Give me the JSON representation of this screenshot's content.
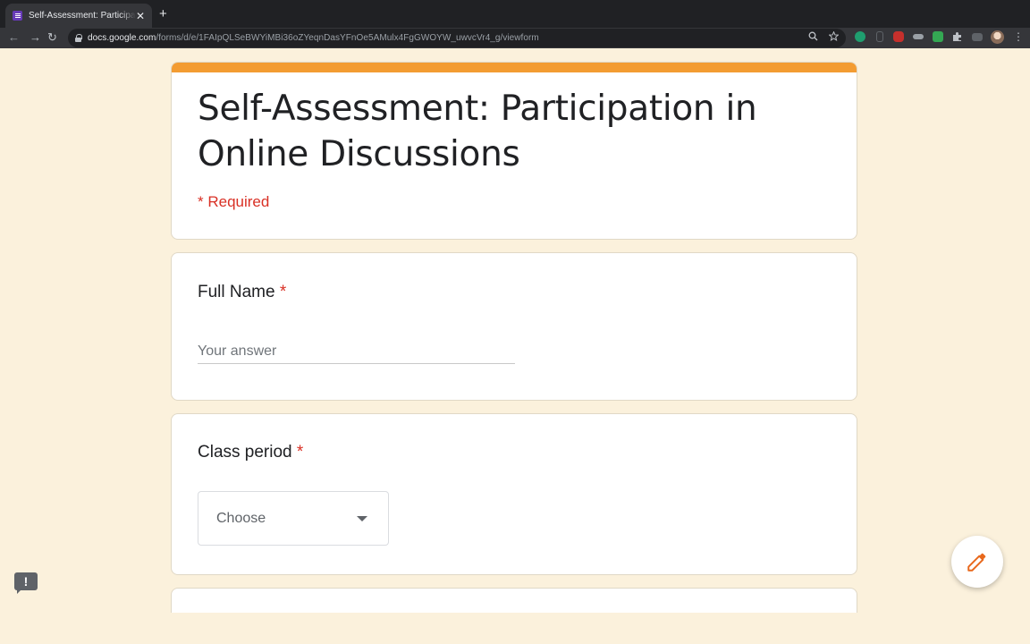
{
  "browser": {
    "tab_title": "Self-Assessment: Participation in Online Discussions",
    "tab_close": "✕",
    "new_tab": "+",
    "nav_back": "←",
    "nav_forward": "→",
    "nav_reload": "↻",
    "url_host": "docs.google.com",
    "url_path": "/forms/d/e/1FAIpQLSeBWYiMBi36oZYeqnDasYFnOe5AMulx4FgGWOYW_uwvcVr4_g/viewform",
    "icons": [
      "search-icon",
      "star-icon",
      "extension-icon",
      "puzzle-icon",
      "avatar",
      "menu-icon"
    ]
  },
  "form": {
    "title": "Self-Assessment: Participation in Online Discussions",
    "required_note": "* Required",
    "accent_color": "#f39c32",
    "background_color": "#fbf1dc",
    "questions": [
      {
        "label": "Full Name",
        "required_marker": "*",
        "placeholder": "Your answer"
      },
      {
        "label": "Class period",
        "required_marker": "*",
        "select_value": "Choose"
      }
    ]
  },
  "floating": {
    "feedback_symbol": "!",
    "edit_icon": "pencil-icon"
  }
}
